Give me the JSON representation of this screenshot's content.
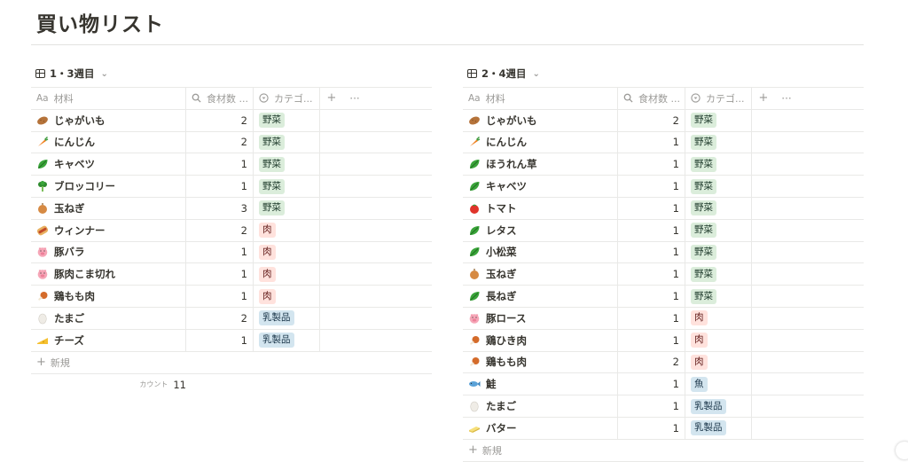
{
  "page": {
    "title": "買い物リスト"
  },
  "columns": {
    "name": "材料",
    "qty": "食材数 ...",
    "cat": "カテゴ...",
    "name_icon": "Aa"
  },
  "new_label": "新規",
  "tag_colors": {
    "野菜": "#dbeddb",
    "肉": "#ffe2dd",
    "乳製品": "#d3e5ef",
    "魚": "#d3e5ef"
  },
  "tables": [
    {
      "view": "1・3週目",
      "rows": [
        {
          "emoji": "potato-icon",
          "name": "じゃがいも",
          "qty": "2",
          "cat": "野菜"
        },
        {
          "emoji": "carrot-icon",
          "name": "にんじん",
          "qty": "2",
          "cat": "野菜"
        },
        {
          "emoji": "leafy-green-icon",
          "name": "キャベツ",
          "qty": "1",
          "cat": "野菜"
        },
        {
          "emoji": "broccoli-icon",
          "name": "ブロッコリー",
          "qty": "1",
          "cat": "野菜"
        },
        {
          "emoji": "onion-icon",
          "name": "玉ねぎ",
          "qty": "3",
          "cat": "野菜"
        },
        {
          "emoji": "hotdog-icon",
          "name": "ウィンナー",
          "qty": "2",
          "cat": "肉"
        },
        {
          "emoji": "pig-icon",
          "name": "豚バラ",
          "qty": "1",
          "cat": "肉"
        },
        {
          "emoji": "pig-icon",
          "name": "豚肉こま切れ",
          "qty": "1",
          "cat": "肉"
        },
        {
          "emoji": "chicken-leg-icon",
          "name": "鶏もも肉",
          "qty": "1",
          "cat": "肉"
        },
        {
          "emoji": "egg-icon",
          "name": "たまご",
          "qty": "2",
          "cat": "乳製品"
        },
        {
          "emoji": "cheese-icon",
          "name": "チーズ",
          "qty": "1",
          "cat": "乳製品"
        }
      ],
      "count_label": "カウント",
      "count_value": "11"
    },
    {
      "view": "2・4週目",
      "rows": [
        {
          "emoji": "potato-icon",
          "name": "じゃがいも",
          "qty": "2",
          "cat": "野菜"
        },
        {
          "emoji": "carrot-icon",
          "name": "にんじん",
          "qty": "1",
          "cat": "野菜"
        },
        {
          "emoji": "leafy-green-icon",
          "name": "ほうれん草",
          "qty": "1",
          "cat": "野菜"
        },
        {
          "emoji": "leafy-green-icon",
          "name": "キャベツ",
          "qty": "1",
          "cat": "野菜"
        },
        {
          "emoji": "tomato-icon",
          "name": "トマト",
          "qty": "1",
          "cat": "野菜"
        },
        {
          "emoji": "leafy-green-icon",
          "name": "レタス",
          "qty": "1",
          "cat": "野菜"
        },
        {
          "emoji": "leafy-green-icon",
          "name": "小松菜",
          "qty": "1",
          "cat": "野菜"
        },
        {
          "emoji": "onion-icon",
          "name": "玉ねぎ",
          "qty": "1",
          "cat": "野菜"
        },
        {
          "emoji": "leafy-green-icon",
          "name": "長ねぎ",
          "qty": "1",
          "cat": "野菜"
        },
        {
          "emoji": "pig-icon",
          "name": "豚ロース",
          "qty": "1",
          "cat": "肉"
        },
        {
          "emoji": "chicken-leg-icon",
          "name": "鶏ひき肉",
          "qty": "1",
          "cat": "肉"
        },
        {
          "emoji": "chicken-leg-icon",
          "name": "鶏もも肉",
          "qty": "2",
          "cat": "肉"
        },
        {
          "emoji": "fish-icon",
          "name": "鮭",
          "qty": "1",
          "cat": "魚"
        },
        {
          "emoji": "egg-icon",
          "name": "たまご",
          "qty": "1",
          "cat": "乳製品"
        },
        {
          "emoji": "butter-icon",
          "name": "バター",
          "qty": "1",
          "cat": "乳製品"
        }
      ]
    }
  ]
}
